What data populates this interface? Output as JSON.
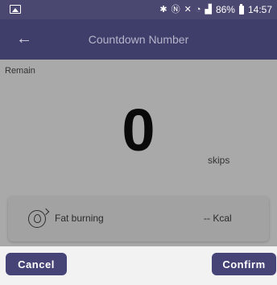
{
  "status_bar": {
    "battery": "86%",
    "time": "14:57"
  },
  "app_bar": {
    "title": "Countdown Number"
  },
  "counter": {
    "label": "Remain",
    "value": "0",
    "unit": "skips"
  },
  "stat": {
    "label": "Fat burning",
    "value": "-- Kcal"
  },
  "buttons": {
    "cancel": "Cancel",
    "confirm": "Confirm"
  },
  "colors": {
    "app_bar": "#3f3d69",
    "button": "#464376",
    "overlay": "#a9a9a9"
  },
  "icons": {
    "back": "arrow-left-icon",
    "stat": "calorie-flame-icon"
  }
}
